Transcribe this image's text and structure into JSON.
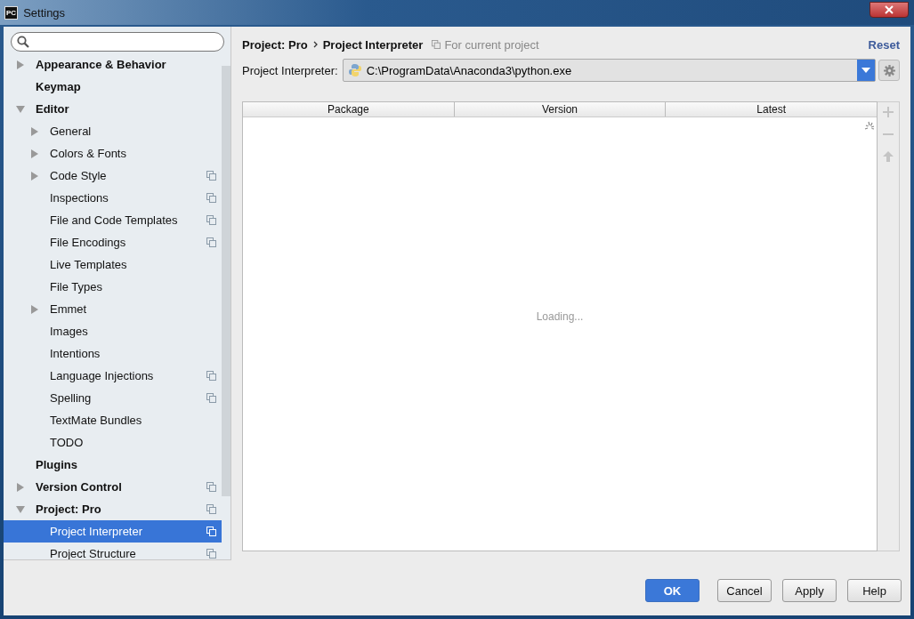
{
  "window": {
    "title": "Settings",
    "logo_text": "PC"
  },
  "tree": [
    {
      "label": "Appearance & Behavior",
      "expanded": false,
      "selected": false,
      "project_level": false
    },
    {
      "label": "Keymap",
      "selected": false,
      "project_level": false
    },
    {
      "label": "Editor",
      "expanded": true,
      "selected": false,
      "project_level": false,
      "children": [
        {
          "label": "General",
          "expanded": false,
          "selected": false,
          "project_level": false
        },
        {
          "label": "Colors & Fonts",
          "expanded": false,
          "selected": false,
          "project_level": false
        },
        {
          "label": "Code Style",
          "expanded": false,
          "selected": false,
          "project_level": true
        },
        {
          "label": "Inspections",
          "selected": false,
          "project_level": true
        },
        {
          "label": "File and Code Templates",
          "selected": false,
          "project_level": true
        },
        {
          "label": "File Encodings",
          "selected": false,
          "project_level": true
        },
        {
          "label": "Live Templates",
          "selected": false,
          "project_level": false
        },
        {
          "label": "File Types",
          "selected": false,
          "project_level": false
        },
        {
          "label": "Emmet",
          "expanded": false,
          "selected": false,
          "project_level": false
        },
        {
          "label": "Images",
          "selected": false,
          "project_level": false
        },
        {
          "label": "Intentions",
          "selected": false,
          "project_level": false
        },
        {
          "label": "Language Injections",
          "selected": false,
          "project_level": true
        },
        {
          "label": "Spelling",
          "selected": false,
          "project_level": true
        },
        {
          "label": "TextMate Bundles",
          "selected": false,
          "project_level": false
        },
        {
          "label": "TODO",
          "selected": false,
          "project_level": false
        }
      ]
    },
    {
      "label": "Plugins",
      "selected": false,
      "project_level": false
    },
    {
      "label": "Version Control",
      "expanded": false,
      "selected": false,
      "project_level": true
    },
    {
      "label": "Project: Pro",
      "expanded": true,
      "selected": false,
      "project_level": true,
      "children": [
        {
          "label": "Project Interpreter",
          "selected": true,
          "project_level": true
        },
        {
          "label": "Project Structure",
          "selected": false,
          "project_level": true
        }
      ]
    }
  ],
  "breadcrumb": [
    "Project: Pro",
    "Project Interpreter"
  ],
  "scope_note": "For current project",
  "reset_link": "Reset",
  "interpreter": {
    "label": "Project Interpreter:",
    "value": "C:\\ProgramData\\Anaconda3\\python.exe"
  },
  "table": {
    "columns": [
      "Package",
      "Version",
      "Latest"
    ],
    "status": "Loading..."
  },
  "buttons": [
    {
      "label": "OK",
      "default": true
    },
    {
      "label": "Cancel",
      "default": false
    },
    {
      "label": "Apply",
      "default": false
    },
    {
      "label": "Help",
      "default": false
    }
  ]
}
